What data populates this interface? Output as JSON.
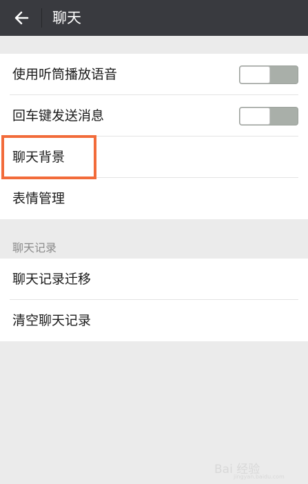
{
  "header": {
    "title": "聊天",
    "back_icon": "arrow-left-icon"
  },
  "settings": {
    "items": [
      {
        "label": "使用听筒播放语音",
        "toggle": "off"
      },
      {
        "label": "回车键发送消息",
        "toggle": "off"
      },
      {
        "label": "聊天背景"
      },
      {
        "label": "表情管理"
      }
    ]
  },
  "history": {
    "section_label": "聊天记录",
    "items": [
      {
        "label": "聊天记录迁移"
      },
      {
        "label": "清空聊天记录"
      }
    ]
  },
  "watermark": {
    "text": "Bai 经验",
    "sub": "jingyan.baidu.com"
  },
  "colors": {
    "topbar": "#393a3f",
    "highlight": "#f26b3a",
    "background": "#ebebeb"
  }
}
